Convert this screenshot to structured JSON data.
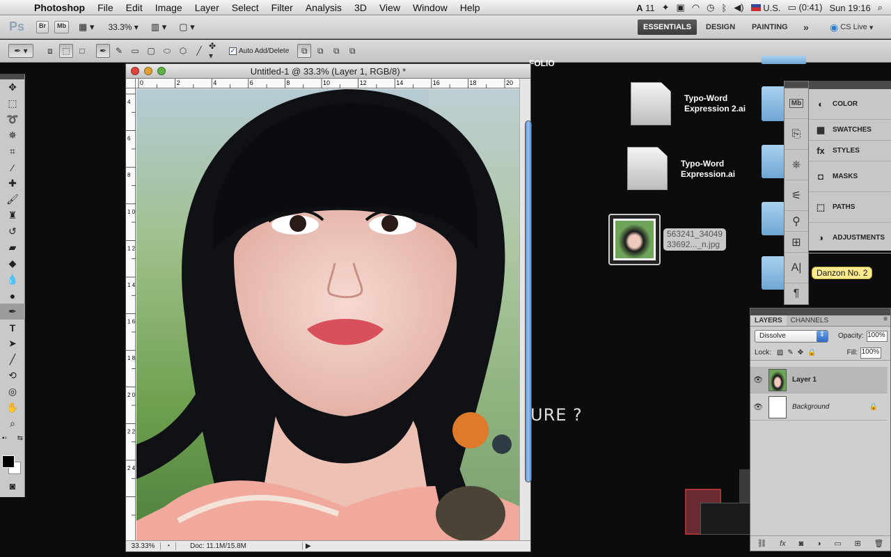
{
  "menubar": {
    "app_name": "Photoshop",
    "menus": [
      "File",
      "Edit",
      "Image",
      "Layer",
      "Select",
      "Filter",
      "Analysis",
      "3D",
      "View",
      "Window",
      "Help"
    ],
    "status": {
      "adobe_count": "11",
      "input_source": "U.S.",
      "battery": "(0:41)",
      "clock": "Sun 19:16"
    }
  },
  "appbar": {
    "logo": "Ps",
    "bridge": "Br",
    "minibridge": "Mb",
    "zoom": "33.3%",
    "workspaces": [
      "ESSENTIALS",
      "DESIGN",
      "PAINTING"
    ],
    "active_workspace": "ESSENTIALS",
    "more": "»",
    "cslive": "CS Live"
  },
  "options": {
    "auto_add_delete": "Auto Add/Delete"
  },
  "document": {
    "title": "Untitled-1 @ 33.3% (Layer 1, RGB/8) *",
    "zoom": "33.33%",
    "doc_size": "Doc: 11.1M/15.8M",
    "ruler_h": [
      "0",
      "2",
      "4",
      "6",
      "8",
      "10",
      "12",
      "14",
      "16",
      "18",
      "20"
    ],
    "ruler_v": [
      "4",
      "6",
      "8",
      "1 0",
      "1 2",
      "1 4",
      "1 6",
      "1 8",
      "2 0",
      "2 2",
      "2 4"
    ]
  },
  "desktop": {
    "folio_text": "FOLIO",
    "bg_text": "URE ?",
    "files": [
      {
        "name_line1": "Typo-Word",
        "name_line2": "Expression 2.ai"
      },
      {
        "name_line1": "Typo-Word",
        "name_line2": "Expression.ai"
      }
    ],
    "image_file": {
      "line1": "563241_34049",
      "line2": "33692..._n.jpg"
    },
    "tooltip": "Danzon No. 2"
  },
  "panels": {
    "collapsed": [
      "COLOR",
      "SWATCHES",
      "STYLES",
      "MASKS",
      "PATHS",
      "ADJUSTMENTS"
    ]
  },
  "layers_panel": {
    "tabs": [
      "LAYERS",
      "CHANNELS"
    ],
    "blend_mode": "Dissolve",
    "opacity_label": "Opacity:",
    "opacity": "100%",
    "lock_label": "Lock:",
    "fill_label": "Fill:",
    "fill": "100%",
    "layers": [
      {
        "name": "Layer 1",
        "selected": true
      },
      {
        "name": "Background",
        "selected": false,
        "locked": true
      }
    ]
  }
}
